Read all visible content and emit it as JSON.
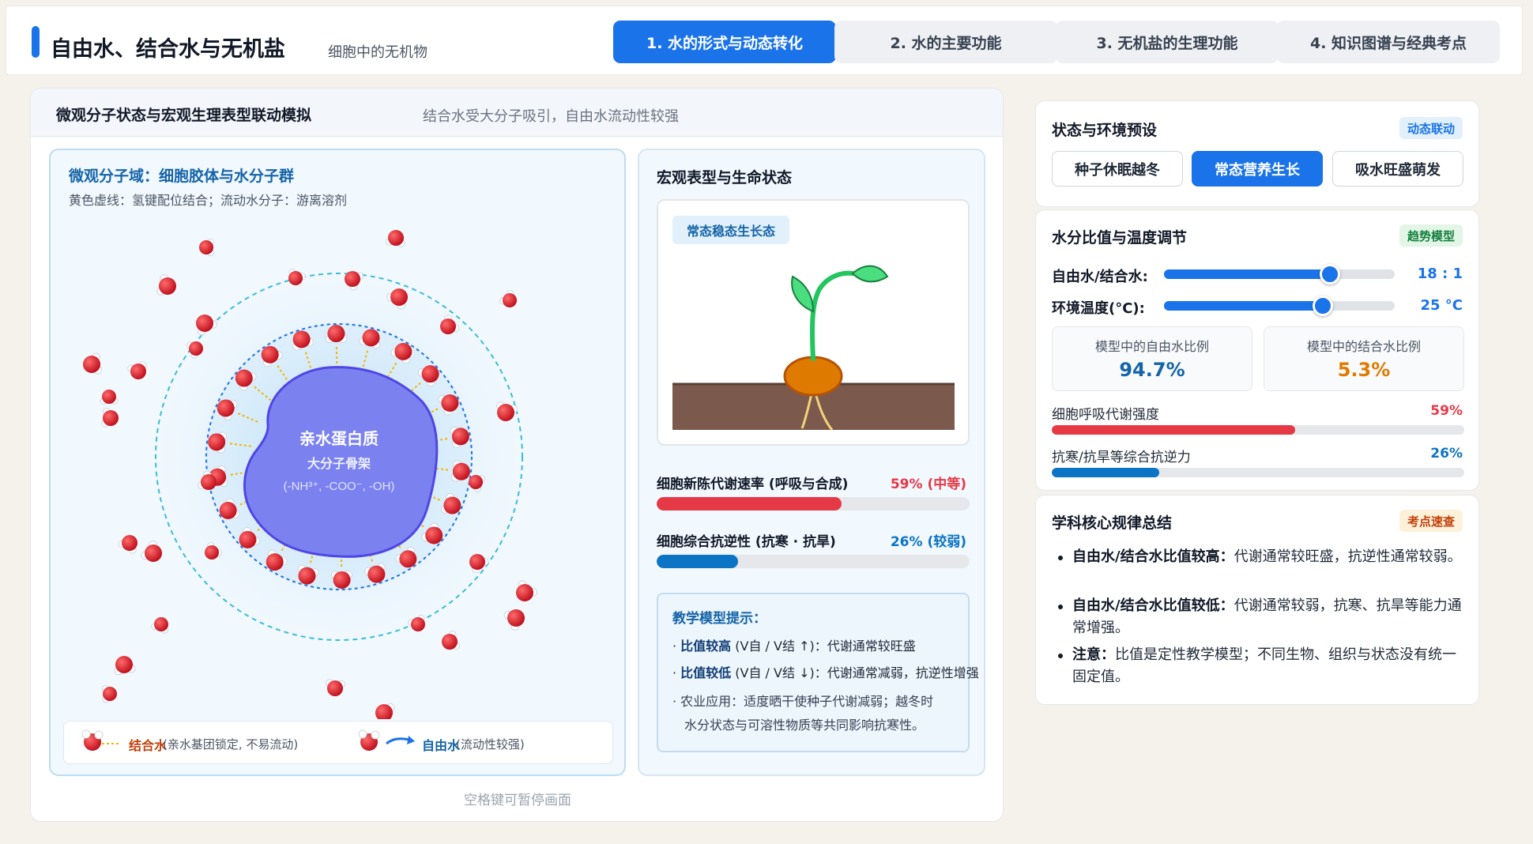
{
  "header": {
    "title": "自由水、结合水与无机盐",
    "subtitle": "细胞中的无机物",
    "tabs": [
      {
        "label": "1. 水的形式与动态转化",
        "active": true
      },
      {
        "label": "2. 水的主要功能",
        "active": false
      },
      {
        "label": "3. 无机盐的生理功能",
        "active": false
      },
      {
        "label": "4. 知识图谱与经典考点",
        "active": false
      }
    ]
  },
  "main": {
    "title": "微观分子状态与宏观生理表型联动模拟",
    "note": "结合水受大分子吸引，自由水流动性较强",
    "micro": {
      "title": "微观分子域：细胞胶体与水分子群",
      "desc": "黄色虚线：氢键配位结合；流动水分子：游离溶剂",
      "protein_title": "亲水蛋白质",
      "protein_sub": "大分子骨架",
      "protein_groups": "(-NH³⁺, -COO⁻, -OH)",
      "legend": {
        "bound_label": "结合水",
        "bound_note": "(亲水基团锁定, 不易流动)",
        "free_label": "自由水",
        "free_note": "(流动性较强)"
      }
    },
    "macro": {
      "title": "宏观表型与生命状态",
      "state_badge": "常态稳态生长态",
      "metabolism_label": "细胞新陈代谢速率 (呼吸与合成)",
      "metabolism_value": "59% (中等)",
      "metabolism_fraction": 0.59,
      "resistance_label": "细胞综合抗逆性 (抗寒 · 抗旱)",
      "resistance_value": "26% (较弱)",
      "resistance_fraction": 0.26,
      "tips": {
        "title": "教学模型提示：",
        "high_bold": "比值较高",
        "high_formula": "(V自 / V结 ↑)",
        "high_text": "：代谢通常较旺盛",
        "low_bold": "比值较低",
        "low_formula": "(V自 / V结 ↓)",
        "low_text": "：代谢通常减弱，抗逆性增强",
        "agri_line1": "农业应用：适度晒干使种子代谢减弱；越冬时",
        "agri_line2": "水分状态与可溶性物质等共同影响抗寒性。"
      }
    },
    "pause_hint": "空格键可暂停画面"
  },
  "presets": {
    "title": "状态与环境预设",
    "badge": "动态联动",
    "buttons": [
      {
        "label": "种子休眠越冬",
        "active": false
      },
      {
        "label": "常态营养生长",
        "active": true
      },
      {
        "label": "吸水旺盛萌发",
        "active": false
      }
    ]
  },
  "controls": {
    "title": "水分比值与温度调节",
    "badge": "趋势模型",
    "ratio_label": "自由水/结合水:",
    "ratio_value": "18 : 1",
    "ratio_fraction": 0.72,
    "temp_label": "环境温度(°C):",
    "temp_value": "25 °C",
    "temp_fraction": 0.69,
    "free_ratio_label": "模型中的自由水比例",
    "free_ratio_value": "94.7%",
    "bound_ratio_label": "模型中的结合水比例",
    "bound_ratio_value": "5.3%",
    "respiration_label": "细胞呼吸代谢强度",
    "respiration_value": "59%",
    "respiration_fraction": 0.59,
    "resistance_label": "抗寒/抗旱等综合抗逆力",
    "resistance_value": "26%",
    "resistance_fraction": 0.26
  },
  "rules": {
    "title": "学科核心规律总结",
    "badge": "考点速查",
    "items": [
      {
        "bold": "自由水/结合水比值较高：",
        "text": "代谢通常较旺盛，抗逆性通常较弱。"
      },
      {
        "bold": "自由水/结合水比值较低：",
        "text": "代谢通常较弱，抗寒、抗旱等能力通常增强。"
      },
      {
        "bold": "注意：",
        "text": "比值是定性教学模型；不同生物、组织与状态没有统一固定值。"
      }
    ]
  },
  "colors": {
    "primary": "#1a73e8",
    "metabolism": "#e63946",
    "resistance": "#0b74c4",
    "free_ratio": "#1464a8",
    "bound_ratio": "#e07b00"
  }
}
